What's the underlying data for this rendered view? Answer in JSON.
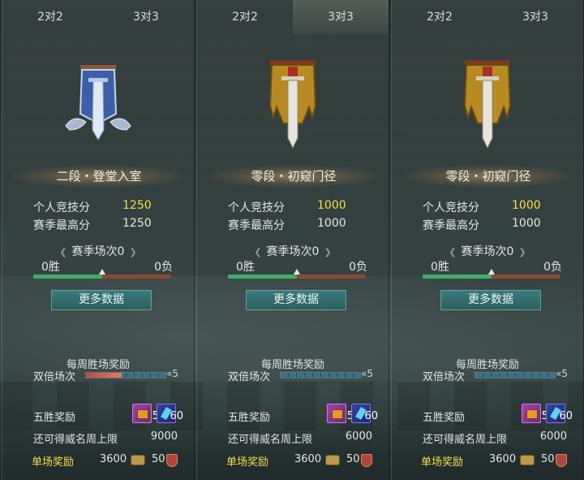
{
  "colors": {
    "accent_yellow": "#f0e04a",
    "win_green": "#3fae6a",
    "loss_red": "#8a4a30",
    "button_teal": "#2c5f60"
  },
  "panels": [
    {
      "tabs": [
        {
          "label": "2对2",
          "active": false
        },
        {
          "label": "3对3",
          "active": false
        }
      ],
      "emblem_icon": "silver-banner-sword-icon",
      "rank": "二段・登堂入室",
      "personal_score_label": "个人竞技分",
      "personal_score": "1250",
      "season_high_label": "赛季最高分",
      "season_high": "1250",
      "season_matches": "赛季场次0",
      "wins": "0胜",
      "losses": "0负",
      "win_ratio": 0.5,
      "more_data": "更多数据",
      "weekly_reward_title": "每周胜场奖励",
      "double_label": "双倍场次",
      "double_count": "5",
      "double_progress": 0.45,
      "five_win_label": "五胜奖励",
      "item1_count": "5",
      "item2_count": "60",
      "cap_label": "还可得威名周上限",
      "cap_value": "9000",
      "single_label": "单场奖励",
      "single_coin": "3600",
      "single_honor": "50"
    },
    {
      "tabs": [
        {
          "label": "2对2",
          "active": false
        },
        {
          "label": "3对3",
          "active": true
        }
      ],
      "emblem_icon": "gold-banner-sword-icon",
      "rank": "零段・初窥门径",
      "personal_score_label": "个人竞技分",
      "personal_score": "1000",
      "season_high_label": "赛季最高分",
      "season_high": "1000",
      "season_matches": "赛季场次0",
      "wins": "0胜",
      "losses": "0负",
      "win_ratio": 0.5,
      "more_data": "更多数据",
      "weekly_reward_title": "每周胜场奖励",
      "double_label": "双倍场次",
      "double_count": "5",
      "double_progress": 0,
      "five_win_label": "五胜奖励",
      "item1_count": "5",
      "item2_count": "60",
      "cap_label": "还可得威名周上限",
      "cap_value": "6000",
      "single_label": "单场奖励",
      "single_coin": "3600",
      "single_honor": "50"
    },
    {
      "tabs": [
        {
          "label": "2对2",
          "active": false
        },
        {
          "label": "3对3",
          "active": false
        }
      ],
      "emblem_icon": "gold-banner-sword-icon",
      "rank": "零段・初窥门径",
      "personal_score_label": "个人竞技分",
      "personal_score": "1000",
      "season_high_label": "赛季最高分",
      "season_high": "1000",
      "season_matches": "赛季场次0",
      "wins": "0胜",
      "losses": "0负",
      "win_ratio": 0.5,
      "more_data": "更多数据",
      "weekly_reward_title": "每周胜场奖励",
      "double_label": "双倍场次",
      "double_count": "5",
      "double_progress": 0,
      "five_win_label": "五胜奖励",
      "item1_count": "5",
      "item2_count": "60",
      "cap_label": "还可得威名周上限",
      "cap_value": "6000",
      "single_label": "单场奖励",
      "single_coin": "3600",
      "single_honor": "50"
    }
  ]
}
